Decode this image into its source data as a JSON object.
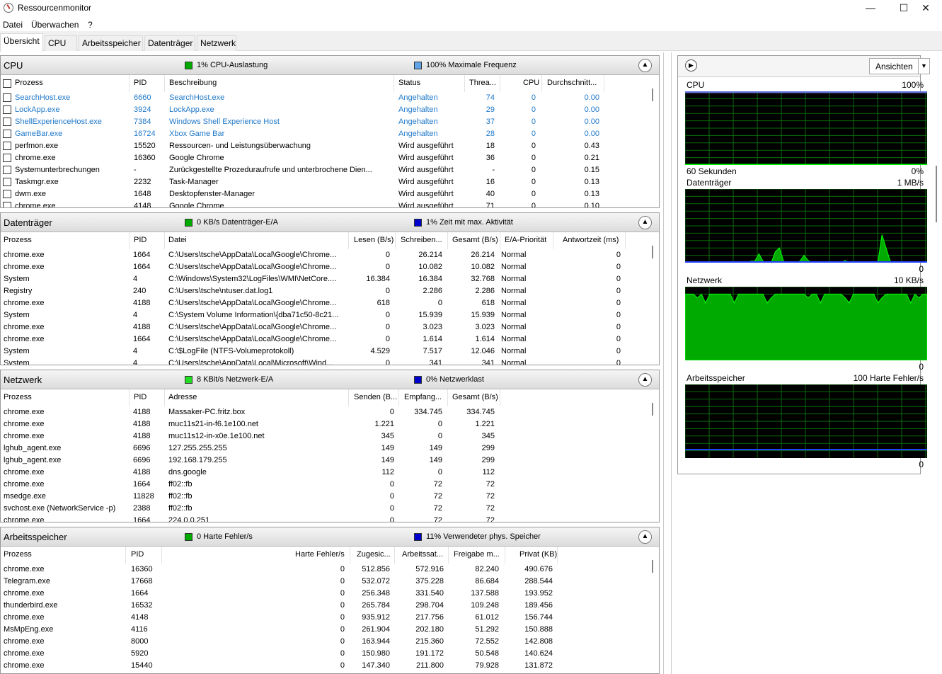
{
  "window": {
    "title": "Ressourcenmonitor",
    "min": "—",
    "max": "☐",
    "close": "✕"
  },
  "menu": [
    "Datei",
    "Überwachen",
    "?"
  ],
  "tabs": [
    "Übersicht",
    "CPU",
    "Arbeitsspeicher",
    "Datenträger",
    "Netzwerk"
  ],
  "colors": {
    "green": "#00aa00",
    "blue": "#0000cc",
    "lightblue": "#5fa3e8",
    "link": "#1f78c8"
  },
  "cpu": {
    "title": "CPU",
    "stat1": "1% CPU-Auslastung",
    "stat2": "100% Maximale Frequenz",
    "columns": [
      "Prozess",
      "PID",
      "Beschreibung",
      "Status",
      "Threa...",
      "CPU",
      "Durchschnitt..."
    ],
    "rows": [
      {
        "p": "SearchHost.exe",
        "pid": "6660",
        "d": "SearchHost.exe",
        "s": "Angehalten",
        "t": "74",
        "c": "0",
        "a": "0.00",
        "blue": true
      },
      {
        "p": "LockApp.exe",
        "pid": "3924",
        "d": "LockApp.exe",
        "s": "Angehalten",
        "t": "29",
        "c": "0",
        "a": "0.00",
        "blue": true
      },
      {
        "p": "ShellExperienceHost.exe",
        "pid": "7384",
        "d": "Windows Shell Experience Host",
        "s": "Angehalten",
        "t": "37",
        "c": "0",
        "a": "0.00",
        "blue": true
      },
      {
        "p": "GameBar.exe",
        "pid": "16724",
        "d": "Xbox Game Bar",
        "s": "Angehalten",
        "t": "28",
        "c": "0",
        "a": "0.00",
        "blue": true
      },
      {
        "p": "perfmon.exe",
        "pid": "15520",
        "d": "Ressourcen- und Leistungsüberwachung",
        "s": "Wird ausgeführt",
        "t": "18",
        "c": "0",
        "a": "0.43",
        "blue": false
      },
      {
        "p": "chrome.exe",
        "pid": "16360",
        "d": "Google Chrome",
        "s": "Wird ausgeführt",
        "t": "36",
        "c": "0",
        "a": "0.21",
        "blue": false
      },
      {
        "p": "Systemunterbrechungen",
        "pid": "-",
        "d": "Zurückgestellte Prozeduraufrufe und unterbrochene Dien...",
        "s": "Wird ausgeführt",
        "t": "-",
        "c": "0",
        "a": "0.15",
        "blue": false
      },
      {
        "p": "Taskmgr.exe",
        "pid": "2232",
        "d": "Task-Manager",
        "s": "Wird ausgeführt",
        "t": "16",
        "c": "0",
        "a": "0.13",
        "blue": false
      },
      {
        "p": "dwm.exe",
        "pid": "1648",
        "d": "Desktopfenster-Manager",
        "s": "Wird ausgeführt",
        "t": "40",
        "c": "0",
        "a": "0.13",
        "blue": false
      },
      {
        "p": "chrome.exe",
        "pid": "4148",
        "d": "Google Chrome",
        "s": "Wird ausgeführt",
        "t": "71",
        "c": "0",
        "a": "0.10",
        "blue": false
      }
    ]
  },
  "disk": {
    "title": "Datenträger",
    "stat1": "0 KB/s Datenträger-E/A",
    "stat2": "1% Zeit mit max. Aktivität",
    "columns": [
      "Prozess",
      "PID",
      "Datei",
      "Lesen (B/s)",
      "Schreiben...",
      "Gesamt (B/s)",
      "E/A-Priorität",
      "Antwortzeit (ms)"
    ],
    "rows": [
      [
        "chrome.exe",
        "1664",
        "C:\\Users\\tsche\\AppData\\Local\\Google\\Chrome...",
        "0",
        "26.214",
        "26.214",
        "Normal",
        "0"
      ],
      [
        "chrome.exe",
        "1664",
        "C:\\Users\\tsche\\AppData\\Local\\Google\\Chrome...",
        "0",
        "10.082",
        "10.082",
        "Normal",
        "0"
      ],
      [
        "System",
        "4",
        "C:\\Windows\\System32\\LogFiles\\WMI\\NetCore....",
        "16.384",
        "16.384",
        "32.768",
        "Normal",
        "0"
      ],
      [
        "Registry",
        "240",
        "C:\\Users\\tsche\\ntuser.dat.log1",
        "0",
        "2.286",
        "2.286",
        "Normal",
        "0"
      ],
      [
        "chrome.exe",
        "4188",
        "C:\\Users\\tsche\\AppData\\Local\\Google\\Chrome...",
        "618",
        "0",
        "618",
        "Normal",
        "0"
      ],
      [
        "System",
        "4",
        "C:\\System Volume Information\\{dba71c50-8c21...",
        "0",
        "15.939",
        "15.939",
        "Normal",
        "0"
      ],
      [
        "chrome.exe",
        "4188",
        "C:\\Users\\tsche\\AppData\\Local\\Google\\Chrome...",
        "0",
        "3.023",
        "3.023",
        "Normal",
        "0"
      ],
      [
        "chrome.exe",
        "1664",
        "C:\\Users\\tsche\\AppData\\Local\\Google\\Chrome...",
        "0",
        "1.614",
        "1.614",
        "Normal",
        "0"
      ],
      [
        "System",
        "4",
        "C:\\$LogFile (NTFS-Volumeprotokoll)",
        "4.529",
        "7.517",
        "12.046",
        "Normal",
        "0"
      ],
      [
        "System",
        "4",
        "C:\\Users\\tsche\\AppData\\Local\\Microsoft\\Wind...",
        "0",
        "341",
        "341",
        "Normal",
        "0"
      ]
    ]
  },
  "net": {
    "title": "Netzwerk",
    "stat1": "8 KBit/s Netzwerk-E/A",
    "stat2": "0% Netzwerklast",
    "columns": [
      "Prozess",
      "PID",
      "Adresse",
      "Senden (B...",
      "Empfang...",
      "Gesamt (B/s)"
    ],
    "rows": [
      [
        "chrome.exe",
        "4188",
        "Massaker-PC.fritz.box",
        "0",
        "334.745",
        "334.745"
      ],
      [
        "chrome.exe",
        "4188",
        "muc11s21-in-f6.1e100.net",
        "1.221",
        "0",
        "1.221"
      ],
      [
        "chrome.exe",
        "4188",
        "muc11s12-in-x0e.1e100.net",
        "345",
        "0",
        "345"
      ],
      [
        "lghub_agent.exe",
        "6696",
        "127.255.255.255",
        "149",
        "149",
        "299"
      ],
      [
        "lghub_agent.exe",
        "6696",
        "192.168.179.255",
        "149",
        "149",
        "299"
      ],
      [
        "chrome.exe",
        "4188",
        "dns.google",
        "112",
        "0",
        "112"
      ],
      [
        "chrome.exe",
        "1664",
        "ff02::fb",
        "0",
        "72",
        "72"
      ],
      [
        "msedge.exe",
        "11828",
        "ff02::fb",
        "0",
        "72",
        "72"
      ],
      [
        "svchost.exe (NetworkService -p)",
        "2388",
        "ff02::fb",
        "0",
        "72",
        "72"
      ],
      [
        "chrome.exe",
        "1664",
        "224.0.0.251",
        "0",
        "72",
        "72"
      ]
    ]
  },
  "mem": {
    "title": "Arbeitsspeicher",
    "stat1": "0 Harte Fehler/s",
    "stat2": "11% Verwendeter phys. Speicher",
    "columns": [
      "Prozess",
      "PID",
      "Harte Fehler/s",
      "Zugesic...",
      "Arbeitssat...",
      "Freigabe m...",
      "Privat (KB)"
    ],
    "rows": [
      [
        "chrome.exe",
        "16360",
        "0",
        "512.856",
        "572.916",
        "82.240",
        "490.676"
      ],
      [
        "Telegram.exe",
        "17668",
        "0",
        "532.072",
        "375.228",
        "86.684",
        "288.544"
      ],
      [
        "chrome.exe",
        "1664",
        "0",
        "256.348",
        "331.540",
        "137.588",
        "193.952"
      ],
      [
        "thunderbird.exe",
        "16532",
        "0",
        "265.784",
        "298.704",
        "109.248",
        "189.456"
      ],
      [
        "chrome.exe",
        "4148",
        "0",
        "935.912",
        "217.756",
        "61.012",
        "156.744"
      ],
      [
        "MsMpEng.exe",
        "4116",
        "0",
        "261.904",
        "202.180",
        "51.292",
        "150.888"
      ],
      [
        "chrome.exe",
        "8000",
        "0",
        "163.944",
        "215.360",
        "72.552",
        "142.808"
      ],
      [
        "chrome.exe",
        "5920",
        "0",
        "150.980",
        "191.172",
        "50.548",
        "140.624"
      ],
      [
        "chrome.exe",
        "15440",
        "0",
        "147.340",
        "211.800",
        "79.928",
        "131.872"
      ]
    ]
  },
  "graphs": {
    "views": "Ansichten",
    "cpu": {
      "label": "CPU",
      "max": "100%",
      "bottom_left": "60 Sekunden",
      "bottom_right": "0%",
      "values_pct": [
        1,
        1,
        1,
        1,
        1,
        1,
        1,
        1,
        1,
        1,
        1,
        1,
        1,
        1,
        1,
        1,
        1,
        1,
        1,
        1,
        1,
        1,
        1,
        1,
        1,
        1,
        1,
        1,
        1,
        1,
        1,
        1,
        1,
        1,
        1,
        1,
        1,
        1,
        1,
        1,
        1,
        1,
        1,
        1,
        1,
        1,
        1,
        1,
        1,
        1,
        1,
        1,
        1,
        1,
        1,
        1,
        1,
        1,
        1,
        1
      ]
    },
    "disk": {
      "label": "Datenträger",
      "max": "1 MB/s",
      "bottom_right": "0",
      "values_pct": [
        0,
        0,
        0,
        0,
        0,
        0,
        0,
        0,
        0,
        0,
        0,
        0,
        0,
        0,
        0,
        0,
        2,
        2,
        12,
        2,
        0,
        0,
        15,
        20,
        2,
        0,
        0,
        0,
        2,
        10,
        3,
        0,
        0,
        0,
        0,
        0,
        0,
        0,
        0,
        3,
        0,
        0,
        0,
        0,
        0,
        0,
        0,
        0,
        38,
        20,
        2,
        0,
        0,
        0,
        0,
        0,
        0,
        0,
        0,
        0
      ]
    },
    "net": {
      "label": "Netzwerk",
      "max": "10 KB/s",
      "bottom_right": "0"
    },
    "mem": {
      "label": "Arbeitsspeicher",
      "max": "100 Harte Fehler/s",
      "bottom_right": "0"
    }
  }
}
